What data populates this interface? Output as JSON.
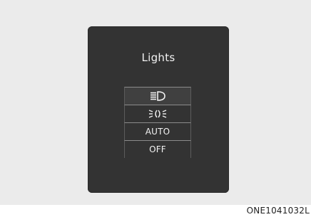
{
  "panel": {
    "title": "Lights"
  },
  "menu": {
    "items": [
      {
        "icon": "headlight-icon"
      },
      {
        "icon": "position-lamp-icon"
      },
      {
        "label": "AUTO"
      },
      {
        "label": "OFF"
      }
    ]
  },
  "caption": "ONE1041032L",
  "colors": {
    "panel_bg": "#333333",
    "frame_bg": "#ebebeb",
    "text": "#f2f2f2"
  }
}
